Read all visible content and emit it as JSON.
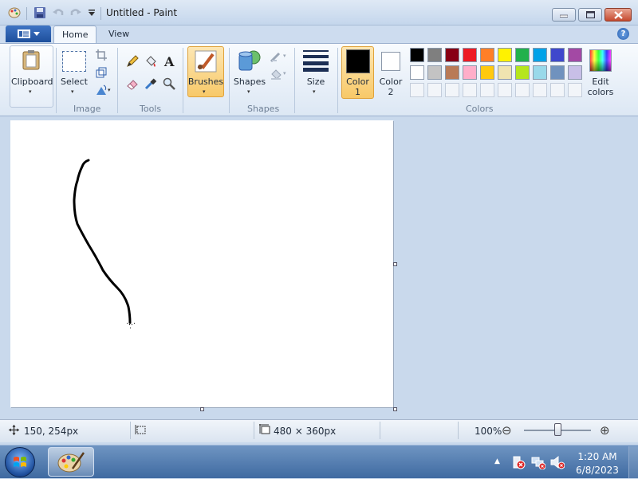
{
  "window": {
    "title": "Untitled - Paint",
    "help_glyph": "?"
  },
  "tabs": [
    {
      "label": "Home",
      "active": true
    },
    {
      "label": "View",
      "active": false
    }
  ],
  "ribbon": {
    "clipboard": {
      "label": "Clipboard",
      "arrow": "▾"
    },
    "image_group": {
      "label": "Image",
      "select_label": "Select",
      "arrow": "▾"
    },
    "tools_group": {
      "label": "Tools"
    },
    "brushes": {
      "label": "Brushes",
      "arrow": "▾"
    },
    "shapes": {
      "label": "Shapes",
      "arrow": "▾"
    },
    "shapes_group": {
      "label": "Shapes"
    },
    "size": {
      "label": "Size",
      "arrow": "▾"
    },
    "color1": {
      "line1": "Color",
      "line2": "1",
      "value": "#000000"
    },
    "color2": {
      "line1": "Color",
      "line2": "2",
      "value": "#ffffff"
    },
    "colors_group": {
      "label": "Colors"
    },
    "edit_colors": {
      "line1": "Edit",
      "line2": "colors"
    }
  },
  "palette": {
    "row1": [
      "#000000",
      "#7f7f7f",
      "#880015",
      "#ed1c24",
      "#ff7f27",
      "#fff200",
      "#22b14c",
      "#00a2e8",
      "#3f48cc",
      "#a349a4"
    ],
    "row2": [
      "#ffffff",
      "#c3c3c3",
      "#b97a57",
      "#ffaec9",
      "#ffc90e",
      "#efe4b0",
      "#b5e61d",
      "#99d9ea",
      "#7092be",
      "#c8bfe7"
    ],
    "row3_count": 10
  },
  "canvas": {
    "background": "#ffffff",
    "stroke_color": "#000000"
  },
  "status": {
    "cursor_pos": "150, 254px",
    "canvas_size": "480 × 360px",
    "zoom": "100%",
    "zoom_out": "⊖",
    "zoom_in": "⊕"
  },
  "taskbar": {
    "time": "1:20 AM",
    "date": "6/8/2023",
    "tray_arrow": "▲"
  }
}
